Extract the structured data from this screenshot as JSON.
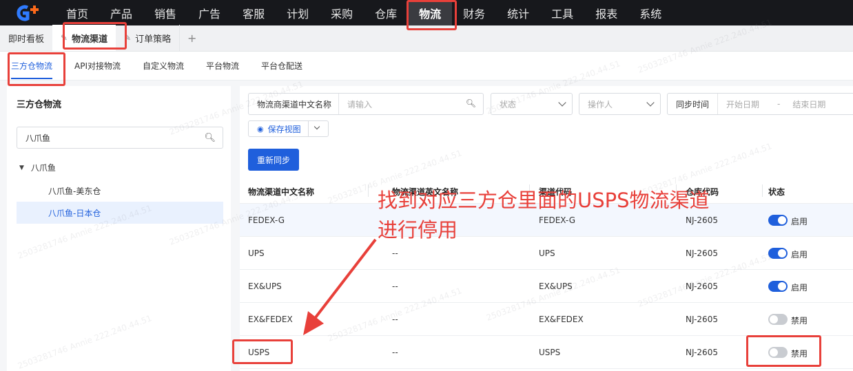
{
  "brand": {
    "logo_icon": "g-plus-logo",
    "accent": "#1f5fdc",
    "nav_bg": "#17181c"
  },
  "topnav": {
    "items": [
      "首页",
      "产品",
      "销售",
      "广告",
      "客服",
      "计划",
      "采购",
      "仓库",
      "物流",
      "财务",
      "统计",
      "工具",
      "报表",
      "系统"
    ],
    "active": "物流"
  },
  "tabs": {
    "items": [
      {
        "label": "即时看板",
        "pinned": false
      },
      {
        "label": "物流渠道",
        "pinned": true
      },
      {
        "label": "订单策略",
        "pinned": true
      }
    ],
    "add_label": "+"
  },
  "subtabs": {
    "items": [
      "三方仓物流",
      "API对接物流",
      "自定义物流",
      "平台物流",
      "平台仓配送"
    ],
    "active": "三方仓物流"
  },
  "left": {
    "title": "三方仓物流",
    "search_value": "八爪鱼",
    "tree_root": "八爪鱼",
    "tree_children": [
      "八爪鱼-美东仓",
      "八爪鱼-日本仓"
    ],
    "selected_child": "八爪鱼-日本仓"
  },
  "filters": {
    "field_select": "物流商渠道中文名称",
    "search_placeholder": "请输入",
    "status_placeholder": "状态",
    "operator_placeholder": "操作人",
    "date_label": "同步时间",
    "start_date_placeholder": "开始日期",
    "date_sep": "-",
    "end_date_placeholder": "结束日期",
    "save_view": "保存视图",
    "resync": "重新同步"
  },
  "table": {
    "columns": [
      "物流渠道中文名称",
      "物流渠道英文名称",
      "渠道代码",
      "仓库代码",
      "状态"
    ],
    "rows": [
      {
        "cn": "FEDEX-G",
        "en": "",
        "code": "FEDEX-G",
        "wh": "NJ-2605",
        "status": "启用",
        "on": true
      },
      {
        "cn": "UPS",
        "en": "--",
        "code": "UPS",
        "wh": "NJ-2605",
        "status": "启用",
        "on": true
      },
      {
        "cn": "EX&UPS",
        "en": "--",
        "code": "EX&UPS",
        "wh": "NJ-2605",
        "status": "启用",
        "on": true
      },
      {
        "cn": "EX&FEDEX",
        "en": "--",
        "code": "EX&FEDEX",
        "wh": "NJ-2605",
        "status": "禁用",
        "on": false
      },
      {
        "cn": "USPS",
        "en": "--",
        "code": "USPS",
        "wh": "NJ-2605",
        "status": "禁用",
        "on": false
      }
    ]
  },
  "annotation": {
    "line1": "找到对应三方仓里面的USPS物流渠道",
    "line2": "进行停用",
    "color": "#e8403a"
  },
  "watermark": "2503281746 Annie 222.240.44.51"
}
